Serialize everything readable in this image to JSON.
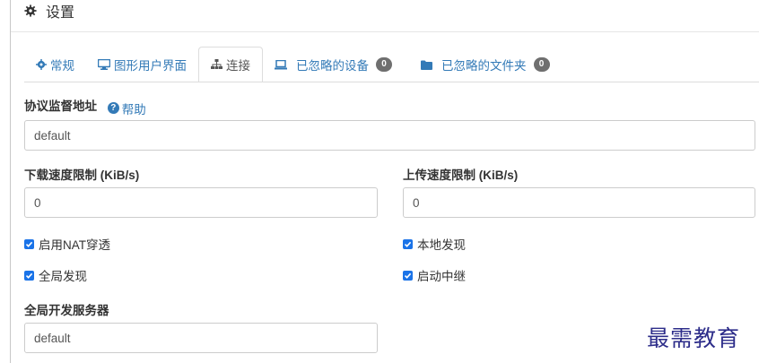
{
  "header": {
    "title": "设置"
  },
  "tabs": [
    {
      "label": "常规",
      "icon": "gear-icon"
    },
    {
      "label": "图形用户界面",
      "icon": "desktop-icon"
    },
    {
      "label": "连接",
      "icon": "sitemap-icon",
      "active": true
    },
    {
      "label": "已忽略的设备",
      "icon": "laptop-icon",
      "badge": "0"
    },
    {
      "label": "已忽略的文件夹",
      "icon": "folder-icon",
      "badge": "0"
    }
  ],
  "form": {
    "listen_label": "协议监督地址",
    "help_label": "帮助",
    "listen_value": "default",
    "download_label": "下载速度限制 (KiB/s)",
    "download_value": "0",
    "upload_label": "上传速度限制 (KiB/s)",
    "upload_value": "0",
    "nat_label": "启用NAT穿透",
    "local_discovery_label": "本地发现",
    "global_discovery_label": "全局发现",
    "relay_label": "启动中继",
    "discovery_server_label": "全局开发服务器",
    "discovery_server_value": "default"
  },
  "watermark": "最需教育",
  "colors": {
    "link": "#337ab7",
    "checkbox": "#1a73e8",
    "badge": "#6f6f6f"
  }
}
